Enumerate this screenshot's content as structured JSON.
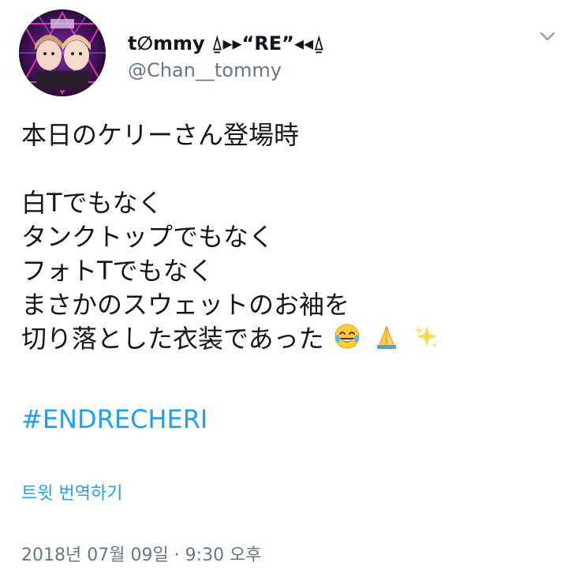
{
  "user": {
    "display_name": "t∅mmy ⍙▸▸“RE”◂◂⍙",
    "handle": "@Chan__tommy",
    "avatar_icon": "user-avatar-photo"
  },
  "header": {
    "more_icon": "chevron-down-icon"
  },
  "tweet": {
    "lines": [
      "本日のケリーさん登場時",
      "",
      "白Tでもなく",
      "タンクトップでもなく",
      "フォトTでもなく",
      "まさかのスウェットのお袖を",
      "切り落とした衣装であった"
    ],
    "emojis": [
      "tears-of-joy-emoji",
      "folded-hands-emoji",
      "sparkles-emoji"
    ],
    "hashtag": "#ENDRECHERI"
  },
  "translate": {
    "label": "트윗 번역하기"
  },
  "meta": {
    "timestamp": "2018년 07월 09일 · 9:30 오후"
  },
  "colors": {
    "link": "#1da1f2",
    "secondary": "#657786",
    "text": "#14171a"
  }
}
